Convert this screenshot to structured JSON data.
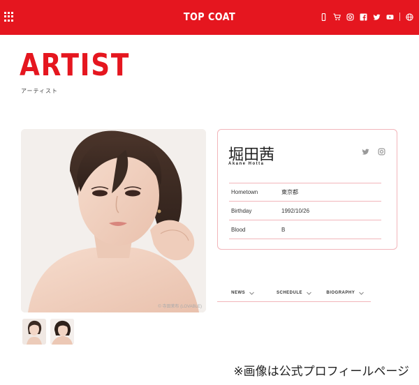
{
  "header": {
    "brand": "TOP COAT",
    "icons": [
      "mobile-icon",
      "cart-icon",
      "instagram-icon",
      "facebook-icon",
      "twitter-icon",
      "youtube-icon",
      "globe-icon"
    ],
    "color": "#e5161f"
  },
  "page": {
    "title": "ARTIST",
    "subtitle": "アーティスト"
  },
  "photo": {
    "credit": "© 寺田茉布 (LOVABLE)"
  },
  "artist": {
    "name": "堀田茜",
    "romaji": "Akane Hotta",
    "social_icons": [
      "twitter-icon",
      "instagram-icon"
    ],
    "info": [
      {
        "label": "Hometown",
        "value": "東京都"
      },
      {
        "label": "Birthday",
        "value": "1992/10/26"
      },
      {
        "label": "Blood",
        "value": "B"
      }
    ]
  },
  "tabs": [
    {
      "label": "NEWS"
    },
    {
      "label": "SCHEDULE"
    },
    {
      "label": "BIOGRAPHY"
    }
  ],
  "footnote": "※画像は公式プロフィールページ",
  "accent_pink": "#f2b5ba"
}
